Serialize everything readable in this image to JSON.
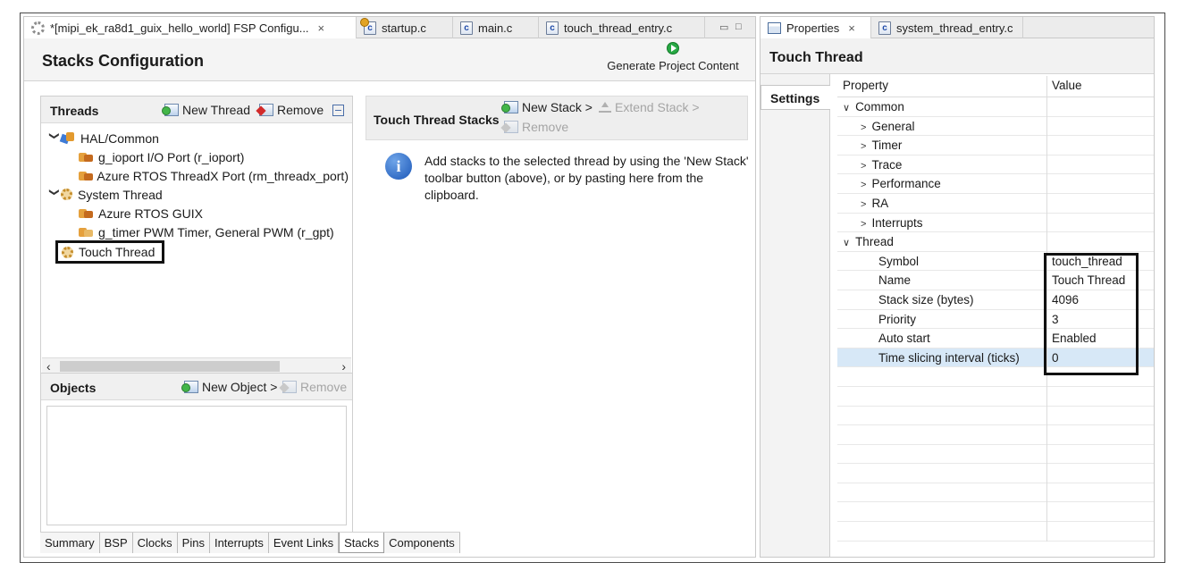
{
  "editor_tabs": [
    {
      "label": "*[mipi_ek_ra8d1_guix_hello_world] FSP Configu...",
      "close": "×"
    },
    {
      "label": "startup.c"
    },
    {
      "label": "main.c"
    },
    {
      "label": "touch_thread_entry.c"
    }
  ],
  "stacks_config": {
    "title": "Stacks Configuration",
    "generate_label": "Generate Project Content"
  },
  "threads": {
    "title": "Threads",
    "new_thread": "New Thread",
    "remove": "Remove",
    "tree": [
      {
        "label": "HAL/Common",
        "level": 0,
        "expanded": true,
        "icon": "hal-common-icon"
      },
      {
        "label": "g_ioport I/O Port (r_ioport)",
        "level": 1,
        "icon": "module-icon"
      },
      {
        "label": "Azure RTOS ThreadX Port (rm_threadx_port)",
        "level": 1,
        "icon": "module-icon"
      },
      {
        "label": "System Thread",
        "level": 0,
        "expanded": true,
        "icon": "thread-gear-icon"
      },
      {
        "label": "Azure RTOS GUIX",
        "level": 1,
        "icon": "module-icon"
      },
      {
        "label": "g_timer PWM Timer, General PWM (r_gpt)",
        "level": 1,
        "icon": "module-icon"
      },
      {
        "label": "Touch Thread",
        "level": 0,
        "icon": "thread-gear-icon",
        "selected": true
      }
    ]
  },
  "objects": {
    "title": "Objects",
    "new_object": "New Object >",
    "remove": "Remove"
  },
  "thread_stacks": {
    "title": "Touch Thread Stacks",
    "new_stack": "New Stack >",
    "extend_stack": "Extend Stack >",
    "remove": "Remove",
    "info": "Add stacks to the selected thread by using the 'New Stack' toolbar button (above), or by pasting here from the clipboard."
  },
  "bottom_tabs": [
    "Summary",
    "BSP",
    "Clocks",
    "Pins",
    "Interrupts",
    "Event Links",
    "Stacks",
    "Components"
  ],
  "active_bottom_tab": "Stacks",
  "right_tabs": [
    {
      "label": "Properties",
      "close": "×"
    },
    {
      "label": "system_thread_entry.c"
    }
  ],
  "properties": {
    "title": "Touch Thread",
    "settings_tab": "Settings",
    "col_property": "Property",
    "col_value": "Value",
    "rows": [
      {
        "name": "Common",
        "level": 0,
        "chevron": "down",
        "value": ""
      },
      {
        "name": "General",
        "level": 1,
        "chevron": "right",
        "value": ""
      },
      {
        "name": "Timer",
        "level": 1,
        "chevron": "right",
        "value": ""
      },
      {
        "name": "Trace",
        "level": 1,
        "chevron": "right",
        "value": ""
      },
      {
        "name": "Performance",
        "level": 1,
        "chevron": "right",
        "value": ""
      },
      {
        "name": "RA",
        "level": 1,
        "chevron": "right",
        "value": ""
      },
      {
        "name": "Interrupts",
        "level": 1,
        "chevron": "right",
        "value": ""
      },
      {
        "name": "Thread",
        "level": 0,
        "chevron": "down",
        "value": ""
      },
      {
        "name": "Symbol",
        "level": 2,
        "value": "touch_thread"
      },
      {
        "name": "Name",
        "level": 2,
        "value": "Touch Thread"
      },
      {
        "name": "Stack size (bytes)",
        "level": 2,
        "value": "4096"
      },
      {
        "name": "Priority",
        "level": 2,
        "value": "3"
      },
      {
        "name": "Auto start",
        "level": 2,
        "value": "Enabled"
      },
      {
        "name": "Time slicing interval (ticks)",
        "level": 2,
        "value": "0",
        "selected": true
      }
    ]
  },
  "colors": {
    "selection": "#d7e8f7",
    "generate_green": "#27a844",
    "info_blue": "#1b57b8"
  }
}
